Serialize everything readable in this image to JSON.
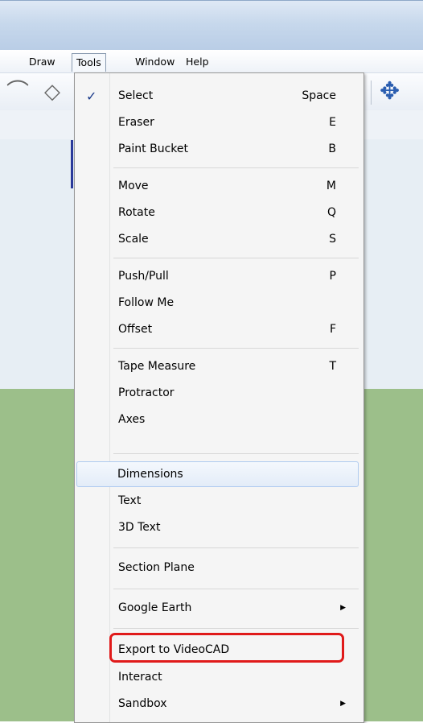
{
  "menubar": {
    "items": [
      {
        "label": "Draw"
      },
      {
        "label": "Tools"
      },
      {
        "label": "Window"
      },
      {
        "label": "Help"
      }
    ]
  },
  "tools_menu": {
    "items": [
      {
        "label": "Select",
        "shortcut": "Space",
        "checked": true
      },
      {
        "label": "Eraser",
        "shortcut": "E"
      },
      {
        "label": "Paint Bucket",
        "shortcut": "B"
      },
      {
        "label": "Move",
        "shortcut": "M"
      },
      {
        "label": "Rotate",
        "shortcut": "Q"
      },
      {
        "label": "Scale",
        "shortcut": "S"
      },
      {
        "label": "Push/Pull",
        "shortcut": "P"
      },
      {
        "label": "Follow Me",
        "shortcut": ""
      },
      {
        "label": "Offset",
        "shortcut": "F"
      },
      {
        "label": "Tape Measure",
        "shortcut": "T"
      },
      {
        "label": "Protractor",
        "shortcut": ""
      },
      {
        "label": "Axes",
        "shortcut": ""
      },
      {
        "label": "Dimensions",
        "shortcut": "",
        "highlighted": true
      },
      {
        "label": "Text",
        "shortcut": ""
      },
      {
        "label": "3D Text",
        "shortcut": ""
      },
      {
        "label": "Section Plane",
        "shortcut": ""
      },
      {
        "label": "Google Earth",
        "shortcut": "",
        "submenu": true
      },
      {
        "label": "Export to VideoCAD",
        "shortcut": "",
        "annotated": true
      },
      {
        "label": "Interact",
        "shortcut": ""
      },
      {
        "label": "Sandbox",
        "shortcut": "",
        "submenu": true
      }
    ],
    "check_glyph": "✓",
    "submenu_glyph": "▶"
  },
  "colors": {
    "annotation_box": "#e01a1a",
    "ground": "#9cbf8a",
    "highlight_border": "#aecaf0"
  }
}
